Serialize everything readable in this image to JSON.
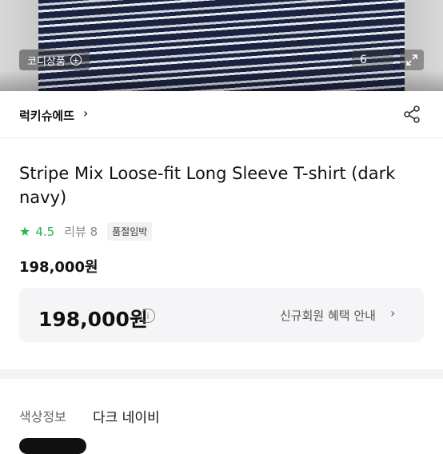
{
  "hero": {
    "codi_label": "코디상품",
    "image_count": "6"
  },
  "brand": {
    "name": "럭키슈에뜨"
  },
  "product": {
    "title": "Stripe Mix Loose-fit Long Sleeve T-shirt (dark navy)",
    "rating": "4.5",
    "reviews": "리뷰 8",
    "stock_badge": "품절임박",
    "price": "198,000원"
  },
  "price_card": {
    "price": "198,000원",
    "benefit_label": "신규회원 혜택 안내"
  },
  "color_info": {
    "label": "색상정보",
    "value": "다크 네이비"
  },
  "colors": {
    "accent_green": "#2bb24c",
    "navy": "#1c2340"
  },
  "icons": {
    "plus": "plus-circle-icon",
    "expand": "expand-icon",
    "chevron": "chevron-right-icon",
    "share": "share-icon",
    "star": "star-icon",
    "info": "info-icon"
  }
}
